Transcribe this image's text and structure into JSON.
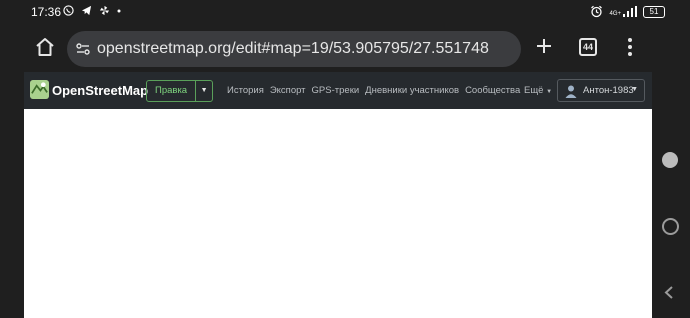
{
  "status_bar": {
    "time": "17:36",
    "network_label": "4G+",
    "battery_level": "51"
  },
  "browser": {
    "url": "openstreetmap.org/edit#map=19/53.905795/27.551748",
    "tab_count": "44"
  },
  "osm": {
    "brand": "OpenStreetMap",
    "edit_label": "Правка",
    "nav": [
      "История",
      "Экспорт",
      "GPS-треки",
      "Дневники участников",
      "Сообщества"
    ],
    "more_label": "Ещё",
    "user_name": "Антон-1983"
  },
  "colors": {
    "status_bg": "#1f1f1f",
    "url_pill": "#3b3c3f",
    "osm_header": "#262a2e",
    "edit_green": "#7fd57f",
    "map_bg": "#ffffff"
  }
}
